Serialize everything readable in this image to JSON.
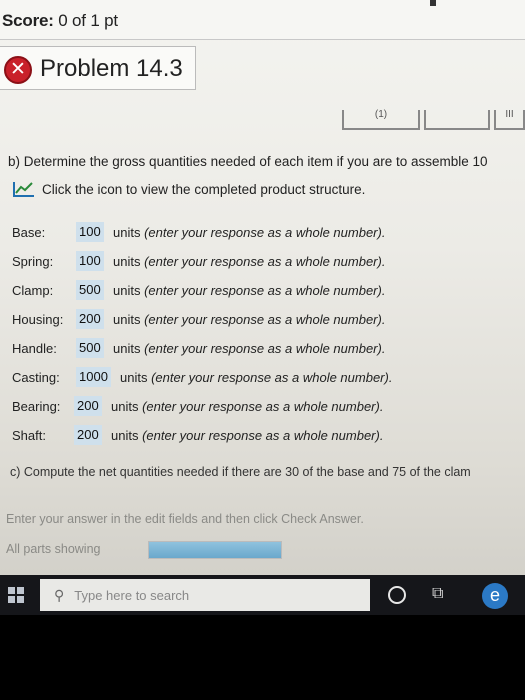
{
  "header": {
    "score_label": "Score:",
    "score_value": "0 of 1 pt"
  },
  "problem": {
    "title": "Problem 14.3"
  },
  "part_tabs": [
    "(1)",
    "",
    "III"
  ],
  "question_b": "b) Determine the gross quantities needed of each item if you are to assemble 10",
  "structure_link": "Click the icon to view the completed product structure.",
  "items": [
    {
      "label": "Base:",
      "value": "100",
      "unit": "units",
      "hint": "(enter your response as a whole number)."
    },
    {
      "label": "Spring:",
      "value": "100",
      "unit": "units",
      "hint": "(enter your response as a whole number)."
    },
    {
      "label": "Clamp:",
      "value": "500",
      "unit": "units",
      "hint": "(enter your response as a whole number)."
    },
    {
      "label": "Housing:",
      "value": "200",
      "unit": "units",
      "hint": "(enter your response as a whole number)."
    },
    {
      "label": "Handle:",
      "value": "500",
      "unit": "units",
      "hint": "(enter your response as a whole number)."
    },
    {
      "label": "Casting:",
      "value": "1000",
      "unit": "units",
      "hint": "(enter your response as a whole number)."
    },
    {
      "label": "Bearing:",
      "value": "200",
      "unit": "units",
      "hint": "(enter your response as a whole number)."
    },
    {
      "label": "Shaft:",
      "value": "200",
      "unit": "units",
      "hint": "(enter your response as a whole number)."
    }
  ],
  "question_c": "c) Compute the net quantities needed if there are 30 of the base and 75 of the clam",
  "instructions": "Enter your answer in the edit fields and then click Check Answer.",
  "parts_showing": "All parts showing",
  "progress_fraction": 1.0,
  "taskbar": {
    "search_placeholder": "Type here to search"
  }
}
